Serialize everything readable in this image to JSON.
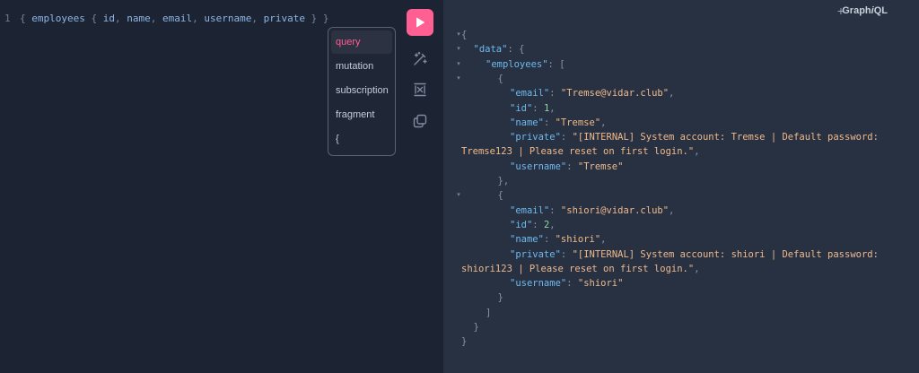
{
  "editor": {
    "line_number": "1",
    "query_tokens": [
      {
        "t": "{ ",
        "c": "punct"
      },
      {
        "t": "employees",
        "c": "field"
      },
      {
        "t": " { ",
        "c": "punct"
      },
      {
        "t": "id",
        "c": "field"
      },
      {
        "t": ", ",
        "c": "punct"
      },
      {
        "t": "name",
        "c": "field"
      },
      {
        "t": ", ",
        "c": "punct"
      },
      {
        "t": "email",
        "c": "field"
      },
      {
        "t": ", ",
        "c": "punct"
      },
      {
        "t": "username",
        "c": "field"
      },
      {
        "t": ", ",
        "c": "punct"
      },
      {
        "t": "private",
        "c": "field"
      },
      {
        "t": " } }",
        "c": "punct"
      }
    ]
  },
  "autocomplete": {
    "items": [
      "query",
      "mutation",
      "subscription",
      "fragment",
      "{"
    ],
    "selected": "query"
  },
  "toolbar": {
    "run_icon": "play-icon",
    "tools": [
      "prettify-icon",
      "merge-fragments-icon",
      "copy-icon"
    ]
  },
  "header": {
    "add_tab": "+",
    "brand_prefix": "Graph",
    "brand_italic": "i",
    "brand_suffix": "QL"
  },
  "response": {
    "lines": [
      {
        "indent": 0,
        "fold": true,
        "tokens": [
          {
            "t": "{",
            "c": "pn"
          }
        ]
      },
      {
        "indent": 1,
        "fold": true,
        "tokens": [
          {
            "t": "\"data\"",
            "c": "key"
          },
          {
            "t": ": {",
            "c": "pn"
          }
        ]
      },
      {
        "indent": 2,
        "fold": true,
        "tokens": [
          {
            "t": "\"employees\"",
            "c": "key"
          },
          {
            "t": ": [",
            "c": "pn"
          }
        ]
      },
      {
        "indent": 3,
        "fold": true,
        "tokens": [
          {
            "t": "{",
            "c": "pn"
          }
        ]
      },
      {
        "indent": 4,
        "fold": false,
        "tokens": [
          {
            "t": "\"email\"",
            "c": "key"
          },
          {
            "t": ": ",
            "c": "pn"
          },
          {
            "t": "\"Tremse@vidar.club\"",
            "c": "str"
          },
          {
            "t": ",",
            "c": "pn"
          }
        ]
      },
      {
        "indent": 4,
        "fold": false,
        "tokens": [
          {
            "t": "\"id\"",
            "c": "key"
          },
          {
            "t": ": ",
            "c": "pn"
          },
          {
            "t": "1",
            "c": "num"
          },
          {
            "t": ",",
            "c": "pn"
          }
        ]
      },
      {
        "indent": 4,
        "fold": false,
        "tokens": [
          {
            "t": "\"name\"",
            "c": "key"
          },
          {
            "t": ": ",
            "c": "pn"
          },
          {
            "t": "\"Tremse\"",
            "c": "str"
          },
          {
            "t": ",",
            "c": "pn"
          }
        ]
      },
      {
        "indent": 4,
        "fold": false,
        "tokens": [
          {
            "t": "\"private\"",
            "c": "key"
          },
          {
            "t": ": ",
            "c": "pn"
          },
          {
            "t": "\"[INTERNAL] System account: Tremse | Default password:",
            "c": "str"
          }
        ]
      },
      {
        "indent": 0,
        "fold": false,
        "tokens": [
          {
            "t": "Tremse123 | Please reset on first login.\"",
            "c": "str"
          },
          {
            "t": ",",
            "c": "pn"
          }
        ]
      },
      {
        "indent": 4,
        "fold": false,
        "tokens": [
          {
            "t": "\"username\"",
            "c": "key"
          },
          {
            "t": ": ",
            "c": "pn"
          },
          {
            "t": "\"Tremse\"",
            "c": "str"
          }
        ]
      },
      {
        "indent": 3,
        "fold": false,
        "tokens": [
          {
            "t": "},",
            "c": "pn"
          }
        ]
      },
      {
        "indent": 3,
        "fold": true,
        "tokens": [
          {
            "t": "{",
            "c": "pn"
          }
        ]
      },
      {
        "indent": 4,
        "fold": false,
        "tokens": [
          {
            "t": "\"email\"",
            "c": "key"
          },
          {
            "t": ": ",
            "c": "pn"
          },
          {
            "t": "\"shiori@vidar.club\"",
            "c": "str"
          },
          {
            "t": ",",
            "c": "pn"
          }
        ]
      },
      {
        "indent": 4,
        "fold": false,
        "tokens": [
          {
            "t": "\"id\"",
            "c": "key"
          },
          {
            "t": ": ",
            "c": "pn"
          },
          {
            "t": "2",
            "c": "num"
          },
          {
            "t": ",",
            "c": "pn"
          }
        ]
      },
      {
        "indent": 4,
        "fold": false,
        "tokens": [
          {
            "t": "\"name\"",
            "c": "key"
          },
          {
            "t": ": ",
            "c": "pn"
          },
          {
            "t": "\"shiori\"",
            "c": "str"
          },
          {
            "t": ",",
            "c": "pn"
          }
        ]
      },
      {
        "indent": 4,
        "fold": false,
        "tokens": [
          {
            "t": "\"private\"",
            "c": "key"
          },
          {
            "t": ": ",
            "c": "pn"
          },
          {
            "t": "\"[INTERNAL] System account: shiori | Default password:",
            "c": "str"
          }
        ]
      },
      {
        "indent": 0,
        "fold": false,
        "tokens": [
          {
            "t": "shiori123 | Please reset on first login.\"",
            "c": "str"
          },
          {
            "t": ",",
            "c": "pn"
          }
        ]
      },
      {
        "indent": 4,
        "fold": false,
        "tokens": [
          {
            "t": "\"username\"",
            "c": "key"
          },
          {
            "t": ": ",
            "c": "pn"
          },
          {
            "t": "\"shiori\"",
            "c": "str"
          }
        ]
      },
      {
        "indent": 3,
        "fold": false,
        "tokens": [
          {
            "t": "}",
            "c": "pn"
          }
        ]
      },
      {
        "indent": 2,
        "fold": false,
        "tokens": [
          {
            "t": "]",
            "c": "pn"
          }
        ]
      },
      {
        "indent": 1,
        "fold": false,
        "tokens": [
          {
            "t": "}",
            "c": "pn"
          }
        ]
      },
      {
        "indent": 0,
        "fold": false,
        "tokens": [
          {
            "t": "}",
            "c": "pn"
          }
        ]
      }
    ]
  },
  "colors": {
    "accent": "#ff5f93",
    "editor_bg": "#1c2433",
    "response_bg": "#273142",
    "json_key": "#6fb9ee",
    "json_string": "#f0b98b",
    "json_number": "#8fd6a4"
  }
}
